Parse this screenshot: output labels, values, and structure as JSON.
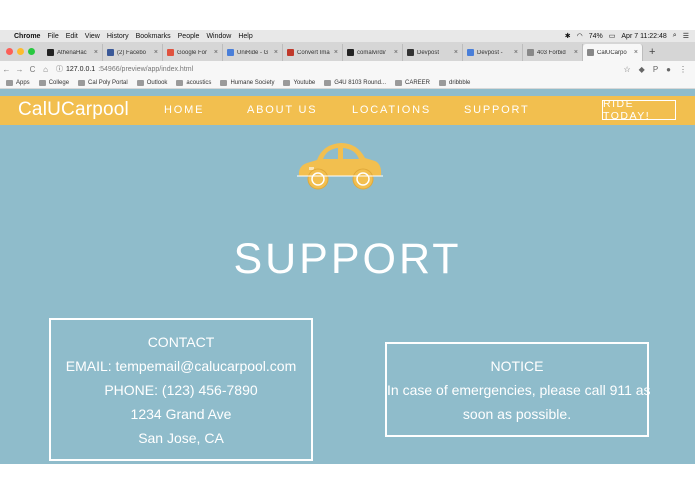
{
  "menubar": {
    "app": "Chrome",
    "items": [
      "File",
      "Edit",
      "View",
      "History",
      "Bookmarks",
      "People",
      "Window",
      "Help"
    ],
    "battery": "74%",
    "clock": "Apr 7  11:22:48"
  },
  "tabs": [
    {
      "title": "AthenaHac",
      "color": "#222222"
    },
    {
      "title": "(2) Facebo",
      "color": "#3b5998"
    },
    {
      "title": "Google For",
      "color": "#e0533f"
    },
    {
      "title": "UniRide - G",
      "color": "#4a7fd9"
    },
    {
      "title": "Convert Ima",
      "color": "#c0392b"
    },
    {
      "title": "comalvirdi/",
      "color": "#222222"
    },
    {
      "title": "Devpost",
      "color": "#333333"
    },
    {
      "title": "Devpost -",
      "color": "#4a7fd9"
    },
    {
      "title": "403 Forbid",
      "color": "#888888"
    },
    {
      "title": "CalUCarpo",
      "color": "#888888"
    }
  ],
  "address": {
    "host": "127.0.0.1",
    "path": ":54966/preview/app/index.html"
  },
  "bookmarks": [
    "Apps",
    "College",
    "Cal Poly Portal",
    "Outlook",
    "acoustics",
    "Humane Society",
    "Youtube",
    "G4U 8103 Round...",
    "CAREER",
    "dribbble"
  ],
  "site": {
    "logo": "CalUCarpool",
    "nav": [
      "HOME",
      "ABOUT US",
      "LOCATIONS",
      "SUPPORT"
    ],
    "cta": "RIDE TODAY!",
    "title": "SUPPORT",
    "contact": {
      "heading": "CONTACT",
      "email": "EMAIL: tempemail@calucarpool.com",
      "phone": "PHONE: (123) 456-7890",
      "street": "1234 Grand Ave",
      "city": "San Jose, CA"
    },
    "notice": {
      "heading": "NOTICE",
      "line1": "In case of emergencies, please call 911 as",
      "line2": "soon as possible."
    },
    "colors": {
      "brand_yellow": "#f2bf4f",
      "background_blue": "#8fbccb"
    }
  }
}
